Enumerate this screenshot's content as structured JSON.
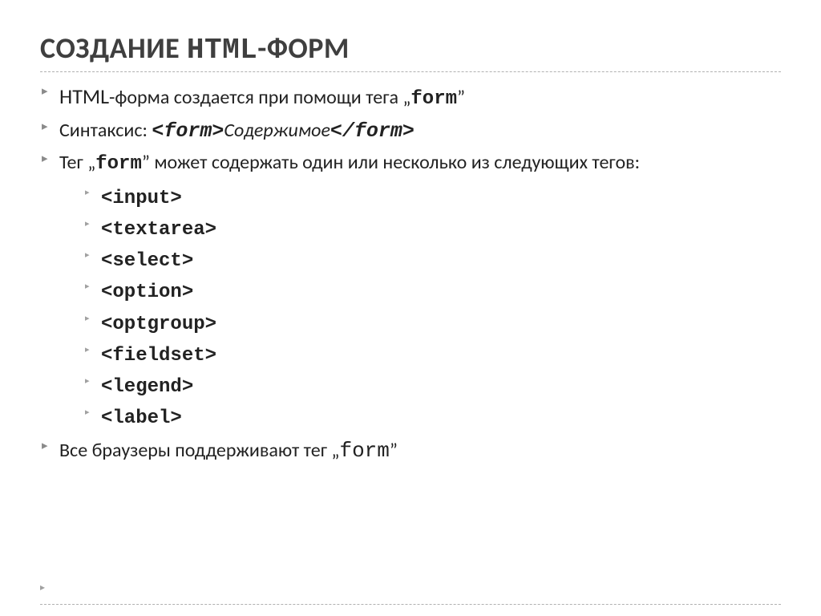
{
  "title": {
    "part1": "СОЗДАНИЕ ",
    "code": "HTML",
    "part2": "-ФОРМ"
  },
  "bullets": {
    "b1": {
      "prefix": "HTML",
      "text1": "-форма создается при помощи тега  „",
      "code": "form",
      "text2": "”"
    },
    "b2": {
      "label": "Синтаксис: ",
      "open": "<form>",
      "mid": "Содержимое",
      "close": "</form>"
    },
    "b3": {
      "t1": "Тег  „",
      "code": "form",
      "t2": "”  может содержать один или несколько из следующих тегов:"
    },
    "tags": [
      "<input>",
      "<textarea>",
      "<select>",
      "<option>",
      "<optgroup>",
      "<fieldset>",
      "<legend>",
      "<label>"
    ],
    "b4": {
      "t1": "Все браузеры поддерживают тег  „",
      "code": "form",
      "t2": "”"
    }
  }
}
